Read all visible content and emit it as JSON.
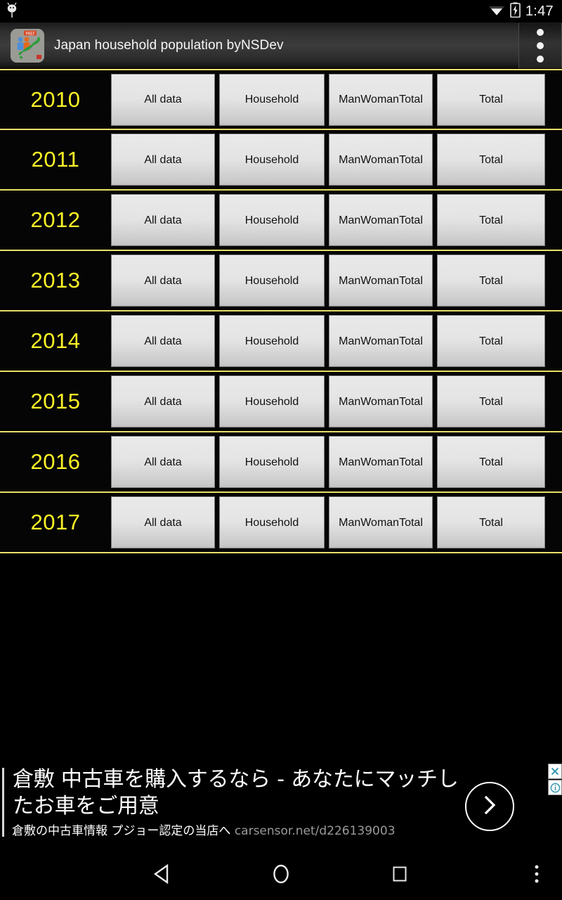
{
  "status_bar": {
    "notification_icon": "android-bug-icon",
    "wifi_icon": "wifi-icon",
    "battery_icon": "battery-charging-icon",
    "time": "1:47"
  },
  "action_bar": {
    "app_icon": "japan-population-app-icon",
    "title": "Japan household population byNSDev",
    "overflow_menu": "overflow-menu-icon"
  },
  "list": {
    "columns": [
      "All data",
      "Household",
      "ManWomanTotal",
      "Total"
    ],
    "rows": [
      {
        "year": "2010",
        "buttons": [
          "All data",
          "Household",
          "ManWomanTotal",
          "Total"
        ]
      },
      {
        "year": "2011",
        "buttons": [
          "All data",
          "Household",
          "ManWomanTotal",
          "Total"
        ]
      },
      {
        "year": "2012",
        "buttons": [
          "All data",
          "Household",
          "ManWomanTotal",
          "Total"
        ]
      },
      {
        "year": "2013",
        "buttons": [
          "All data",
          "Household",
          "ManWomanTotal",
          "Total"
        ]
      },
      {
        "year": "2014",
        "buttons": [
          "All data",
          "Household",
          "ManWomanTotal",
          "Total"
        ]
      },
      {
        "year": "2015",
        "buttons": [
          "All data",
          "Household",
          "ManWomanTotal",
          "Total"
        ]
      },
      {
        "year": "2016",
        "buttons": [
          "All data",
          "Household",
          "ManWomanTotal",
          "Total"
        ]
      },
      {
        "year": "2017",
        "buttons": [
          "All data",
          "Household",
          "ManWomanTotal",
          "Total"
        ]
      }
    ]
  },
  "ad": {
    "headline": "倉敷 中古車を購入するなら - あなたにマッチしたお車をご用意",
    "description": "倉敷の中古車情報 プジョー認定の当店へ",
    "url": "carsensor.net/d226139003",
    "cta_icon": "chevron-right-icon",
    "close_label": "✕",
    "info_label": "ⓘ"
  },
  "nav_bar": {
    "back": "back-triangle-icon",
    "home": "home-circle-icon",
    "recents": "recents-square-icon",
    "menu": "nav-overflow-icon"
  },
  "colors": {
    "divider_yellow": "#e8e06a",
    "year_yellow": "#fbf327",
    "button_face": "#e4e4e4",
    "background": "#000000",
    "ad_link_gray": "#9a9a9a",
    "ad_icon_teal": "#3a9ab0"
  }
}
